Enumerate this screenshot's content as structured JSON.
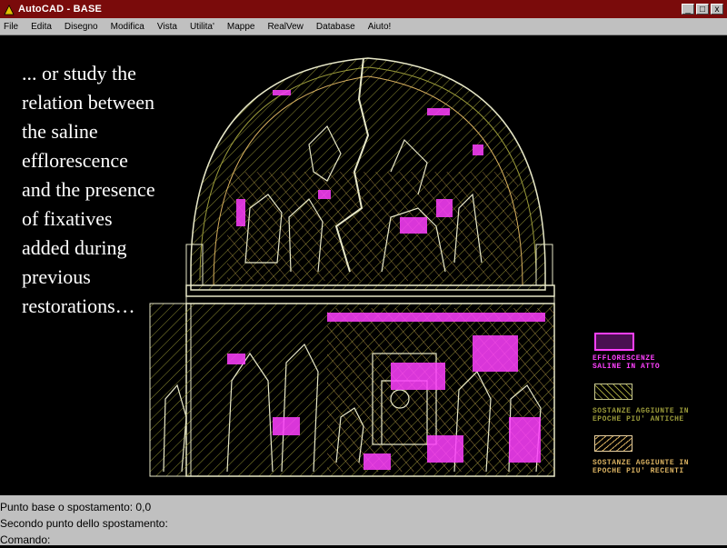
{
  "window": {
    "title": "AutoCAD - BASE",
    "controls": [
      "_",
      "□",
      "x"
    ]
  },
  "menu": {
    "items": [
      "File",
      "Edita",
      "Disegno",
      "Modifica",
      "Vista",
      "Utilita'",
      "Mappe",
      "RealVew",
      "Database",
      "Aiuto!"
    ]
  },
  "overlay": {
    "lines": [
      "... or study the",
      "relation between",
      "the saline",
      "efflorescence",
      "and the presence",
      "of fixatives",
      "added during",
      "previous",
      "restorations…"
    ]
  },
  "legend": {
    "items": [
      {
        "label1": "EFFLORESCENZE",
        "label2": "SALINE IN ATTO",
        "color": "#ff40ff"
      },
      {
        "label1": "SOSTANZE AGGIUNTE IN",
        "label2": "EPOCHE PIU' ANTICHE",
        "color": "#9a9a3a"
      },
      {
        "label1": "SOSTANZE AGGIUNTE IN",
        "label2": "EPOCHE PIU' RECENTI",
        "color": "#d8b060"
      }
    ]
  },
  "command": {
    "lines": [
      "Punto base o spostamento: 0,0",
      "Secondo punto dello spostamento:",
      "Comando:"
    ]
  },
  "colors": {
    "titlebar": "#7a0b0b",
    "chrome": "#c0c0c0",
    "drawing_bg": "#000000",
    "outline": "#e8e8c8",
    "efflorescence": "#ff40ff",
    "old_fixatives": "#9a9a3a",
    "recent_fixatives": "#d8b060"
  }
}
